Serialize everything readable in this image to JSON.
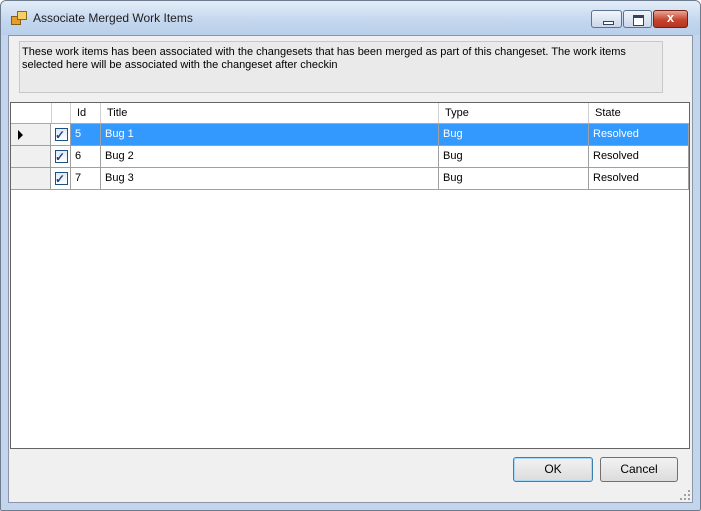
{
  "window": {
    "title": "Associate Merged Work Items",
    "close_glyph": "x"
  },
  "description": "These work items has been associated with the changesets that has been merged as part of this changeset. The work items selected here will be associated with the changeset after checkin",
  "grid": {
    "columns": [
      "Id",
      "Title",
      "Type",
      "State"
    ],
    "rows": [
      {
        "checked": true,
        "id": "5",
        "title": "Bug 1",
        "type": "Bug",
        "state": "Resolved",
        "selected": true
      },
      {
        "checked": true,
        "id": "6",
        "title": "Bug 2",
        "type": "Bug",
        "state": "Resolved",
        "selected": false
      },
      {
        "checked": true,
        "id": "7",
        "title": "Bug 3",
        "type": "Bug",
        "state": "Resolved",
        "selected": false
      }
    ]
  },
  "buttons": {
    "ok": "OK",
    "cancel": "Cancel"
  },
  "icons": {
    "app": "merged-work-items-icon",
    "row_pointer": "current-row-arrow-icon",
    "check": "✓"
  },
  "colors": {
    "selection": "#3399ff",
    "title_bar": "#c3d6ee",
    "close_button": "#c7452f"
  }
}
